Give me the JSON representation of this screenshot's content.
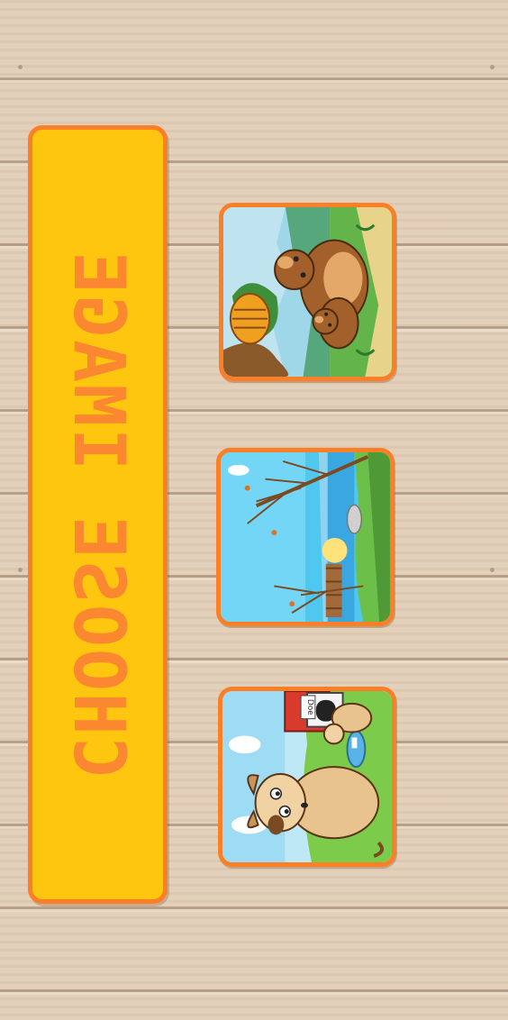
{
  "screen": {
    "title": "CHOOSE IMAGE"
  },
  "thumbnails": [
    {
      "subject": "bears-with-beehive",
      "sign_text": ""
    },
    {
      "subject": "lake-pier-sunset",
      "sign_text": ""
    },
    {
      "subject": "dogs-with-doghouse",
      "sign_text": "Doe"
    }
  ],
  "colors": {
    "panel_fill": "#ffc60f",
    "panel_border": "#fb7f27",
    "title_text": "#fb8830",
    "wood_background": "#e2cdb6"
  }
}
